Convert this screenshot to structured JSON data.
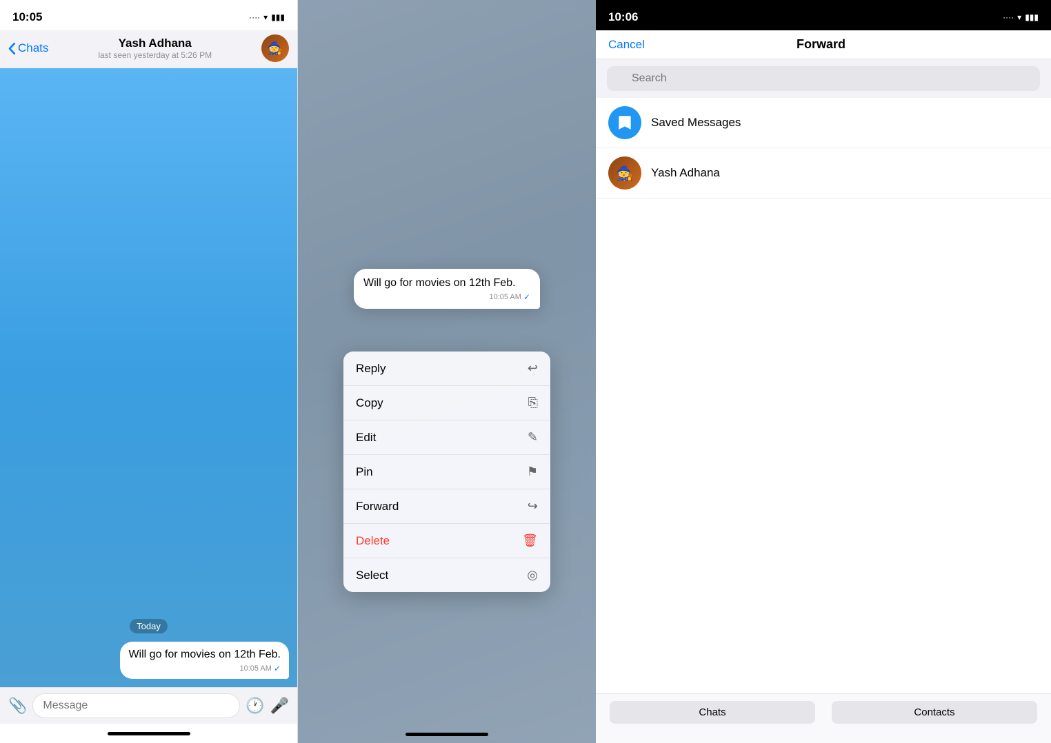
{
  "panel1": {
    "statusBar": {
      "time": "10:05",
      "icons": ".... ▾ 🔋"
    },
    "header": {
      "back": "Chats",
      "name": "Yash Adhana",
      "status": "last seen yesterday at 5:26 PM"
    },
    "body": {
      "dateSeparator": "Today",
      "message": "Will go for movies on 12th Feb.",
      "messageTime": "10:05 AM",
      "messageCheck": "✓"
    },
    "inputBar": {
      "placeholder": "Message"
    }
  },
  "panel2": {
    "contextMessage": {
      "text": "Will go for movies on 12th Feb.",
      "time": "10:05 AM",
      "check": "✓"
    },
    "menu": [
      {
        "label": "Reply",
        "icon": "↩",
        "id": "reply"
      },
      {
        "label": "Copy",
        "icon": "⎘",
        "id": "copy"
      },
      {
        "label": "Edit",
        "icon": "✎",
        "id": "edit"
      },
      {
        "label": "Pin",
        "icon": "📌",
        "id": "pin"
      },
      {
        "label": "Forward",
        "icon": "↪",
        "id": "forward"
      },
      {
        "label": "Delete",
        "icon": "🗑",
        "id": "delete",
        "isDelete": true
      },
      {
        "label": "Select",
        "icon": "◎",
        "id": "select"
      }
    ]
  },
  "panel3": {
    "statusBar": {
      "time": "10:06",
      "icons": ".... ▾ 🔋"
    },
    "header": {
      "cancel": "Cancel",
      "title": "Forward"
    },
    "search": {
      "placeholder": "Search"
    },
    "list": [
      {
        "id": "saved-messages",
        "name": "Saved Messages",
        "avatarType": "saved",
        "avatarIcon": "🔖"
      },
      {
        "id": "yash-adhana",
        "name": "Yash Adhana",
        "avatarType": "yash",
        "avatarIcon": "🧙"
      }
    ],
    "tabs": [
      {
        "label": "Chats",
        "id": "chats-tab"
      },
      {
        "label": "Contacts",
        "id": "contacts-tab"
      }
    ]
  }
}
